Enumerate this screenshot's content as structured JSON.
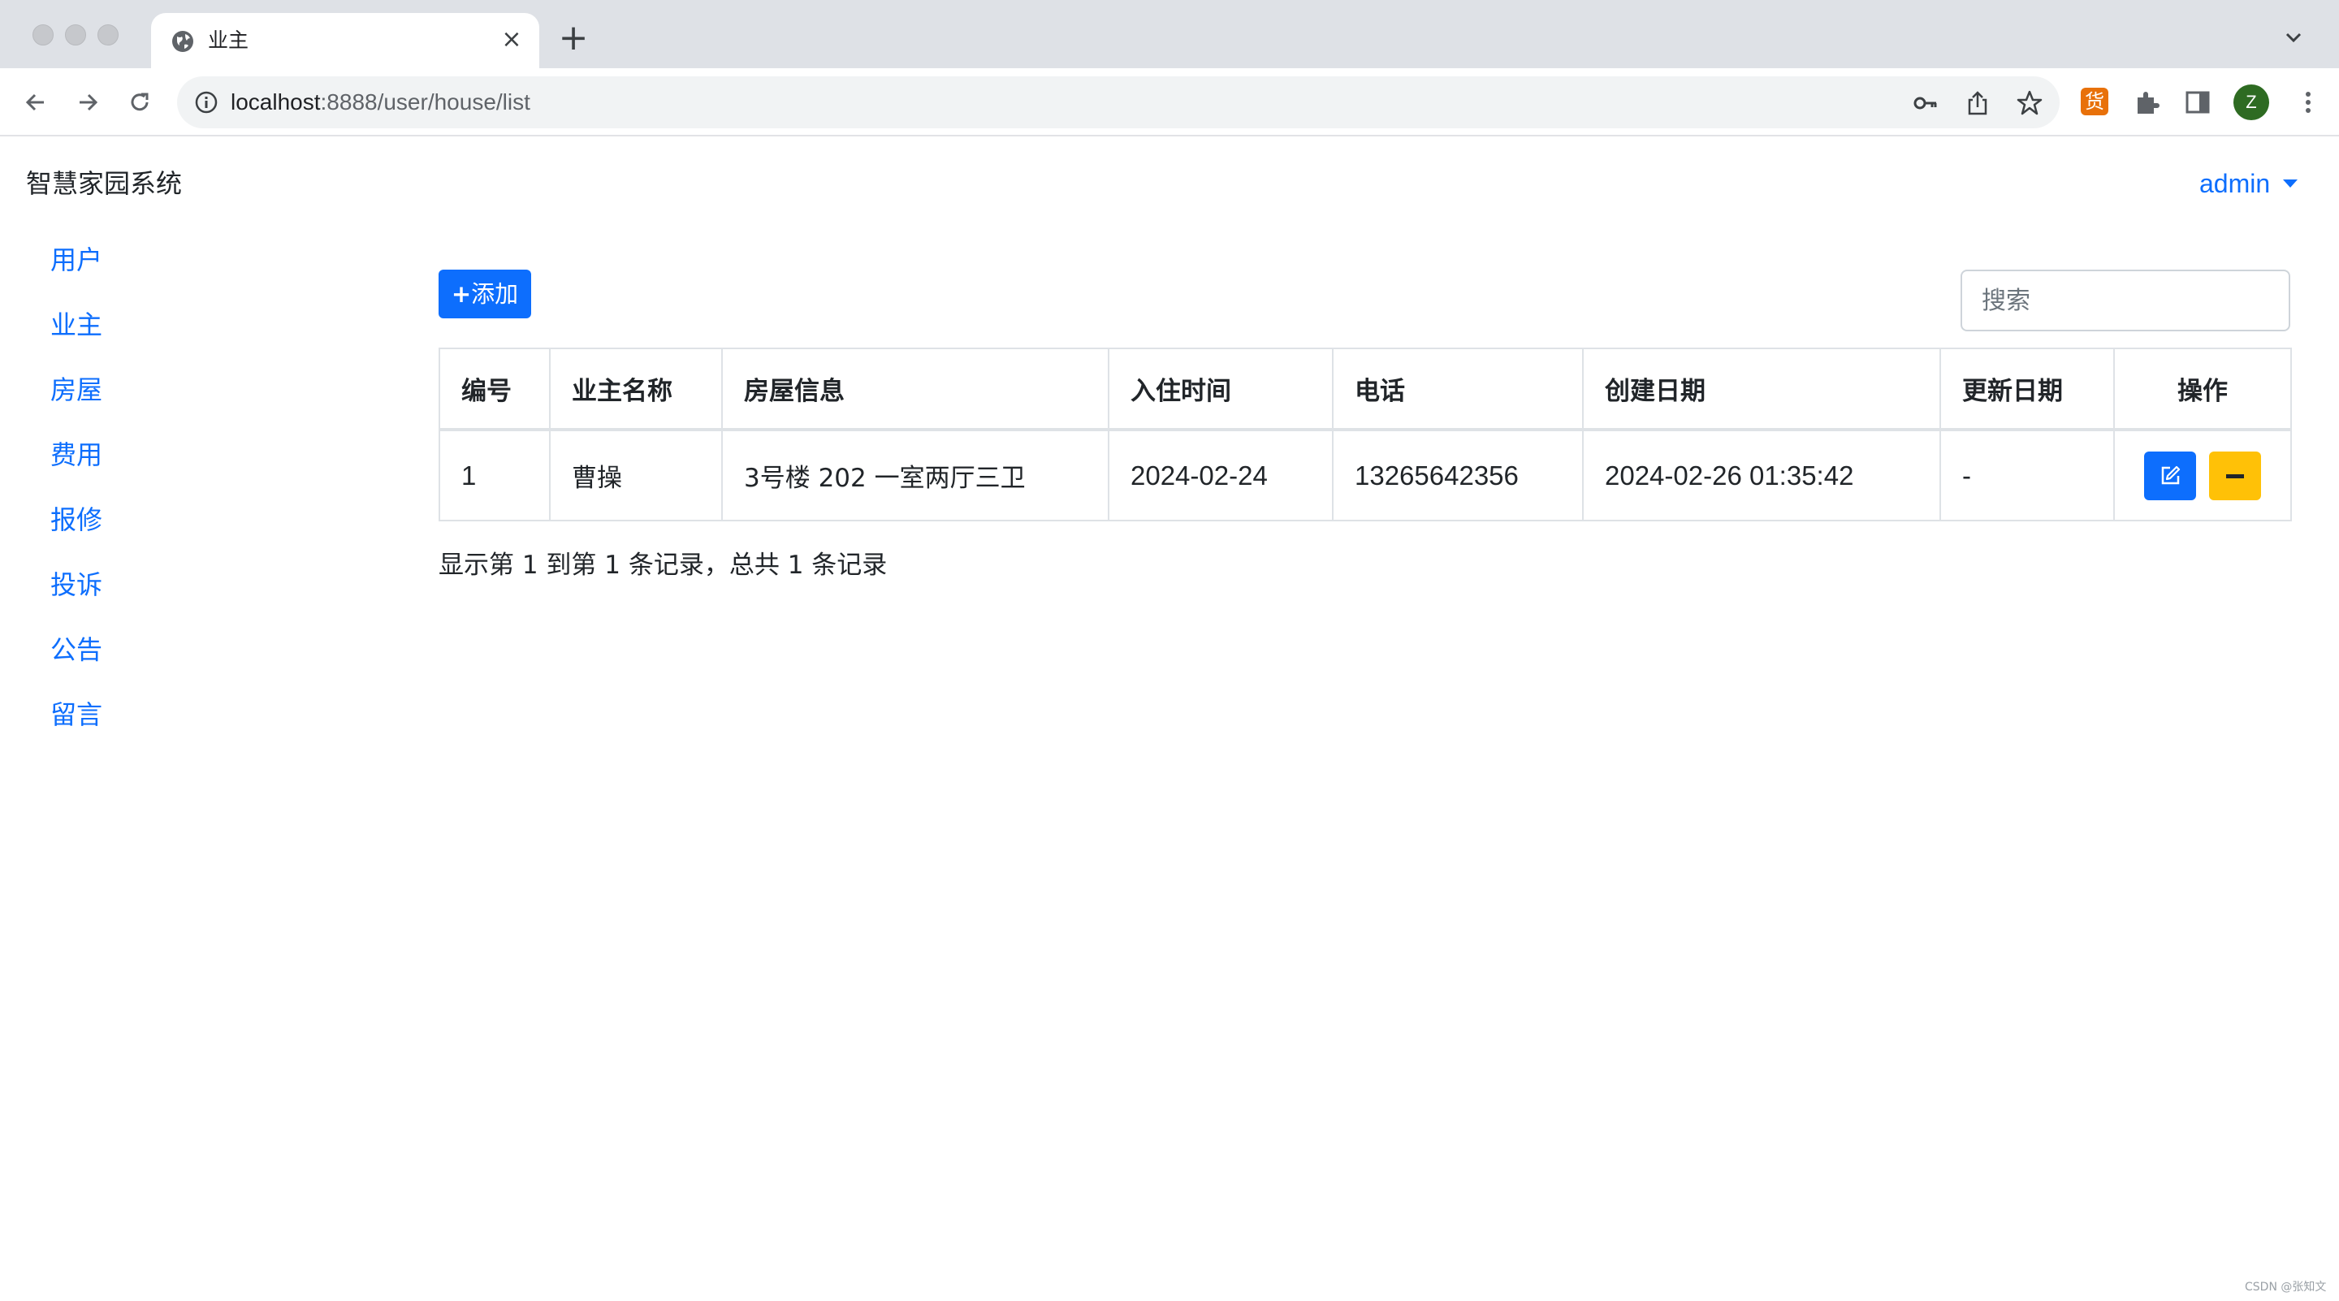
{
  "browser": {
    "tab_title": "业主",
    "url_host": "localhost",
    "url_rest": ":8888/user/house/list",
    "profile_initial": "Z",
    "extension_label": "货",
    "accent": "#0d6efd"
  },
  "header": {
    "brand": "智慧家园系统",
    "user": "admin"
  },
  "sidebar": {
    "items": [
      {
        "label": "用户"
      },
      {
        "label": "业主"
      },
      {
        "label": "房屋"
      },
      {
        "label": "费用"
      },
      {
        "label": "报修"
      },
      {
        "label": "投诉"
      },
      {
        "label": "公告"
      },
      {
        "label": "留言"
      }
    ]
  },
  "toolbar": {
    "add_label": "添加",
    "search_placeholder": "搜索"
  },
  "table": {
    "columns": [
      "编号",
      "业主名称",
      "房屋信息",
      "入住时间",
      "电话",
      "创建日期",
      "更新日期",
      "操作"
    ],
    "rows": [
      {
        "id": "1",
        "owner": "曹操",
        "house": "3号楼 202 一室两厅三卫",
        "move_in": "2024-02-24",
        "phone": "13265642356",
        "created": "2024-02-26 01:35:42",
        "updated": "-"
      }
    ]
  },
  "footer": {
    "summary": "显示第 1 到第 1 条记录，总共 1 条记录"
  },
  "watermark": "CSDN @张知文",
  "icons": {
    "edit": "edit-icon",
    "remove": "minus-icon"
  },
  "colors": {
    "primary": "#0d6efd",
    "warning": "#ffc107"
  }
}
